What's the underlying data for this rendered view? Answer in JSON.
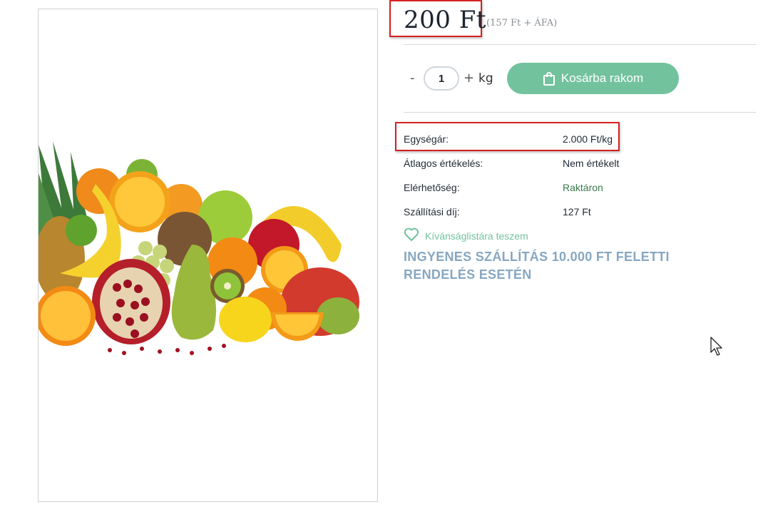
{
  "product": {
    "price": "200 Ft",
    "price_net": "(157 Ft + ÁFA)",
    "image_alt": "fruits-image"
  },
  "quantity": {
    "minus": "-",
    "value": "1",
    "plus": "+",
    "unit": "kg"
  },
  "cart": {
    "label": "Kosárba rakom",
    "icon": "shopping-bag-icon"
  },
  "details": [
    {
      "label": "Egységár:",
      "value": "2.000 Ft/kg"
    },
    {
      "label": "Átlagos értékelés:",
      "value": "Nem értékelt"
    },
    {
      "label": "Elérhetőség:",
      "value": "Raktáron"
    },
    {
      "label": "Szállítási díj:",
      "value": "127 Ft"
    }
  ],
  "wishlist": {
    "label": "Kívánságlistára teszem",
    "icon": "heart-icon"
  },
  "shipping_note": "INGYENES SZÁLLÍTÁS 10.000 FT FELETTI RENDELÉS ESETÉN",
  "colors": {
    "accent": "#72c29e",
    "highlight_border": "#d42121",
    "note": "#87a7c1"
  }
}
